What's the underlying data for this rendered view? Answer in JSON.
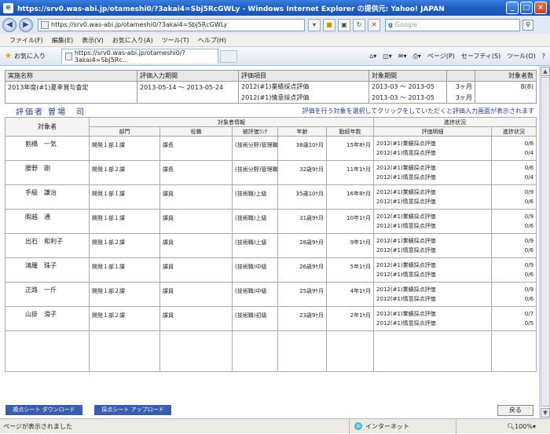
{
  "window": {
    "title": "https://srv0.was-abi.jp/otameshi0/?3akai4=Sbj5RcGWLy - Windows Internet Explorer の提供元: Yahoo! JAPAN",
    "app_icon": "e"
  },
  "address": {
    "url": "https://srv0.was-abi.jp/otameshi0/?3akai4=Sbj5RcGWLy",
    "search_placeholder": "Google"
  },
  "menu": {
    "items": [
      "ファイル(F)",
      "編集(E)",
      "表示(V)",
      "お気に入り(A)",
      "ツール(T)",
      "ヘルプ(H)"
    ]
  },
  "favorites": {
    "label": "お気に入り"
  },
  "tab": {
    "title": "https://srv0.was-abi.jp/otameshi0/?3akai4=Sbj5Rc..."
  },
  "commands": {
    "page": "ページ(P)",
    "safety": "セーフティ(S)",
    "tools": "ツール(O)",
    "help": "?"
  },
  "info": {
    "headers": [
      "実施名称",
      "評価入力期間",
      "評価項目",
      "対象期間",
      "",
      "対象者数"
    ],
    "name": "2013年度(#1)夏季賞与査定",
    "period": "2013-05-14 ～ 2013-05-24",
    "items": [
      "2012(#1)業績採点評価",
      "2012(#1)情意採点評価"
    ],
    "target_periods": [
      "2013-03 ～ 2013-05",
      "2013-03 ～ 2013-05"
    ],
    "months": [
      "3ヶ月",
      "3ヶ月"
    ],
    "count": "8(8)"
  },
  "evaluator": {
    "name": "評価者 曽場　司",
    "note": "評価を行う対象を選択してクリックをしていただくと評価入力画面が表示されます"
  },
  "table": {
    "h_target": "対象者",
    "h_info": "対象者情報",
    "h_progress": "進捗状況",
    "h_dept": "部門",
    "h_role": "役職",
    "h_rank": "被評価ﾗﾝｸ",
    "h_age": "年齢",
    "h_years": "勤続年数",
    "h_detail": "評価明細",
    "h_status": "進捗状況",
    "rows": [
      {
        "name": "割橋　一気",
        "dept": "開発１部１課",
        "role": "課長",
        "rank": "(技術分野)管理職",
        "age": "38歳10ｹ月",
        "years": "15年8ｹ月",
        "items": [
          "2012(#1)業績採点評価",
          "2012(#1)情意採点評価"
        ],
        "status": [
          "0/6",
          "0/4"
        ]
      },
      {
        "name": "腰野　剛",
        "dept": "開発１部２課",
        "role": "課長",
        "rank": "(技術分野)管理職",
        "age": "32歳9ｹ月",
        "years": "11年1ｹ月",
        "items": [
          "2012(#1)業績採点評価",
          "2012(#1)情意採点評価"
        ],
        "status": [
          "0/6",
          "0/4"
        ]
      },
      {
        "name": "手級　謙治",
        "dept": "開発１部１課",
        "role": "課員",
        "rank": "(技術職)上級",
        "age": "35歳10ｹ月",
        "years": "16年8ｹ月",
        "items": [
          "2012(#1)業績採点評価",
          "2012(#1)情意採点評価"
        ],
        "status": [
          "0/9",
          "0/6"
        ]
      },
      {
        "name": "暇越　通",
        "dept": "開発１部１課",
        "role": "課員",
        "rank": "(技術職)上級",
        "age": "31歳9ｹ月",
        "years": "10年1ｹ月",
        "items": [
          "2012(#1)業績採点評価",
          "2012(#1)情意採点評価"
        ],
        "status": [
          "0/9",
          "0/6"
        ]
      },
      {
        "name": "出石　和利子",
        "dept": "開発１部２課",
        "role": "課員",
        "rank": "(技術職)上級",
        "age": "28歳9ｹ月",
        "years": "9年1ｹ月",
        "items": [
          "2012(#1)業績採点評価",
          "2012(#1)情意採点評価"
        ],
        "status": [
          "0/9",
          "0/6"
        ]
      },
      {
        "name": "鴻羅　珠子",
        "dept": "開発１部１課",
        "role": "課員",
        "rank": "(技術職)中級",
        "age": "26歳9ｹ月",
        "years": "5年1ｹ月",
        "items": [
          "2012(#1)業績採点評価",
          "2012(#1)情意採点評価"
        ],
        "status": [
          "0/9",
          "0/6"
        ]
      },
      {
        "name": "正路　一斤",
        "dept": "開発１部２課",
        "role": "課員",
        "rank": "(技術職)中級",
        "age": "25歳9ｹ月",
        "years": "4年1ｹ月",
        "items": [
          "2012(#1)業績採点評価",
          "2012(#1)情意採点評価"
        ],
        "status": [
          "0/9",
          "0/6"
        ]
      },
      {
        "name": "山掛　滑子",
        "dept": "開発１部２課",
        "role": "課員",
        "rank": "(技術職)初級",
        "age": "23歳9ｹ月",
        "years": "2年1ｹ月",
        "items": [
          "2012(#1)業績採点評価",
          "2012(#1)情意採点評価"
        ],
        "status": [
          "0/7",
          "0/5"
        ]
      }
    ]
  },
  "buttons": {
    "download": "複点シート ダウンロード",
    "upload": "採点シート アップロード",
    "back": "戻る"
  },
  "status": {
    "message": "ページが表示されました",
    "zone": "インターネット",
    "protected": "",
    "zoom": "100%"
  }
}
